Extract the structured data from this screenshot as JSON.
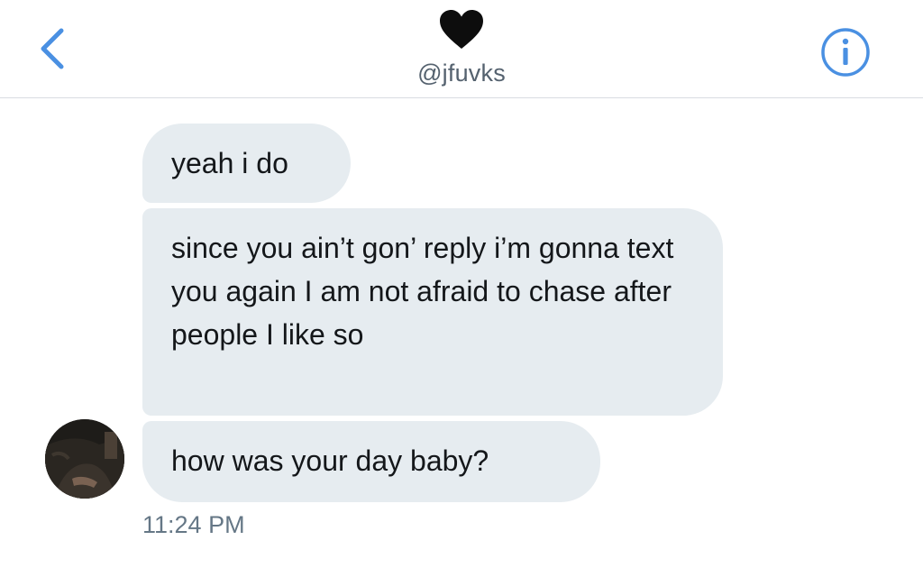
{
  "header": {
    "back_icon": "chevron-left-icon",
    "title_icon": "black-heart-icon",
    "handle": "@jfuvks",
    "info_icon": "info-icon",
    "accent_color": "#4a90e2"
  },
  "messages": [
    {
      "text": "yeah i do"
    },
    {
      "text": "since you ain’t gon’ reply i’m gonna text you again I am not afraid to chase after people I like so"
    },
    {
      "text": "how was your day baby?"
    }
  ],
  "timestamp": "11:24 PM",
  "bubble_color": "#e6ecf0"
}
